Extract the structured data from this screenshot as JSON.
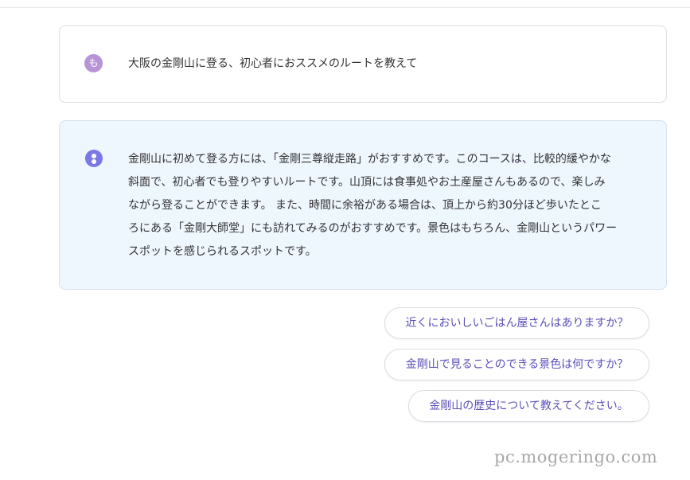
{
  "user_message": {
    "avatar_char": "も",
    "text": "大阪の金剛山に登る、初心者におススメのルートを教えて"
  },
  "assistant_message": {
    "avatar_icon": "assistant-dots-icon",
    "lines": [
      "金剛山に初めて登る方には、「金剛三尊縦走路」がおすすめです。このコースは、比較的緩やかな",
      "斜面で、初心者でも登りやすいルートです。山頂には食事処やお土産屋さんもあるので、楽しみ",
      "ながら登ることができます。 また、時間に余裕がある場合は、頂上から約30分ほど歩いたとこ",
      "ろにある「金剛大師堂」にも訪れてみるのがおすすめです。景色はもちろん、金剛山というパワー",
      "スポットを感じられるスポットです。"
    ]
  },
  "suggestions": [
    "近くにおいしいごはん屋さんはありますか？",
    "金剛山で見ることのできる景色は何ですか？",
    "金剛山の歴史について教えてください。"
  ],
  "watermark": "pc.mogeringo.com",
  "colors": {
    "user_avatar": "#b694d6",
    "assistant_avatar": "#7a78e8",
    "assistant_bg": "#eef6fe",
    "suggestion_text": "#5a4fb8"
  }
}
